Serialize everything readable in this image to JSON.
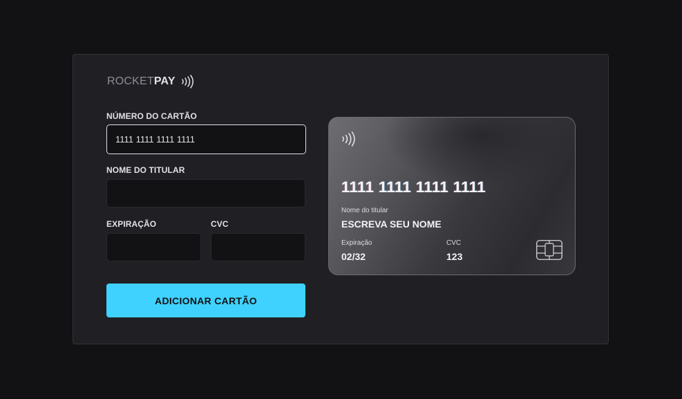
{
  "brand": {
    "name_light": "ROCKET",
    "name_bold": "PAY",
    "icon": "contactless-icon"
  },
  "form": {
    "card_number": {
      "label": "NÚMERO DO CARTÃO",
      "value": "1111 1111 1111 1111",
      "placeholder": ""
    },
    "holder_name": {
      "label": "NOME DO TITULAR",
      "value": "",
      "placeholder": ""
    },
    "expiration": {
      "label": "EXPIRAÇÃO",
      "value": "",
      "placeholder": ""
    },
    "cvc": {
      "label": "CVC",
      "value": "",
      "placeholder": ""
    },
    "submit_label": "ADICIONAR CARTÃO"
  },
  "card_preview": {
    "number": "1111 1111 1111 1111",
    "holder_label": "Nome do titular",
    "holder_value": "ESCREVA SEU NOME",
    "expiration_label": "Expiração",
    "expiration_value": "02/32",
    "cvc_label": "CVC",
    "cvc_value": "123",
    "icons": [
      "contactless-icon",
      "chip-icon"
    ]
  },
  "colors": {
    "background": "#121214",
    "panel": "#202024",
    "input_bg": "#121214",
    "accent": "#3fd2fe",
    "text": "#e1e1e6"
  }
}
